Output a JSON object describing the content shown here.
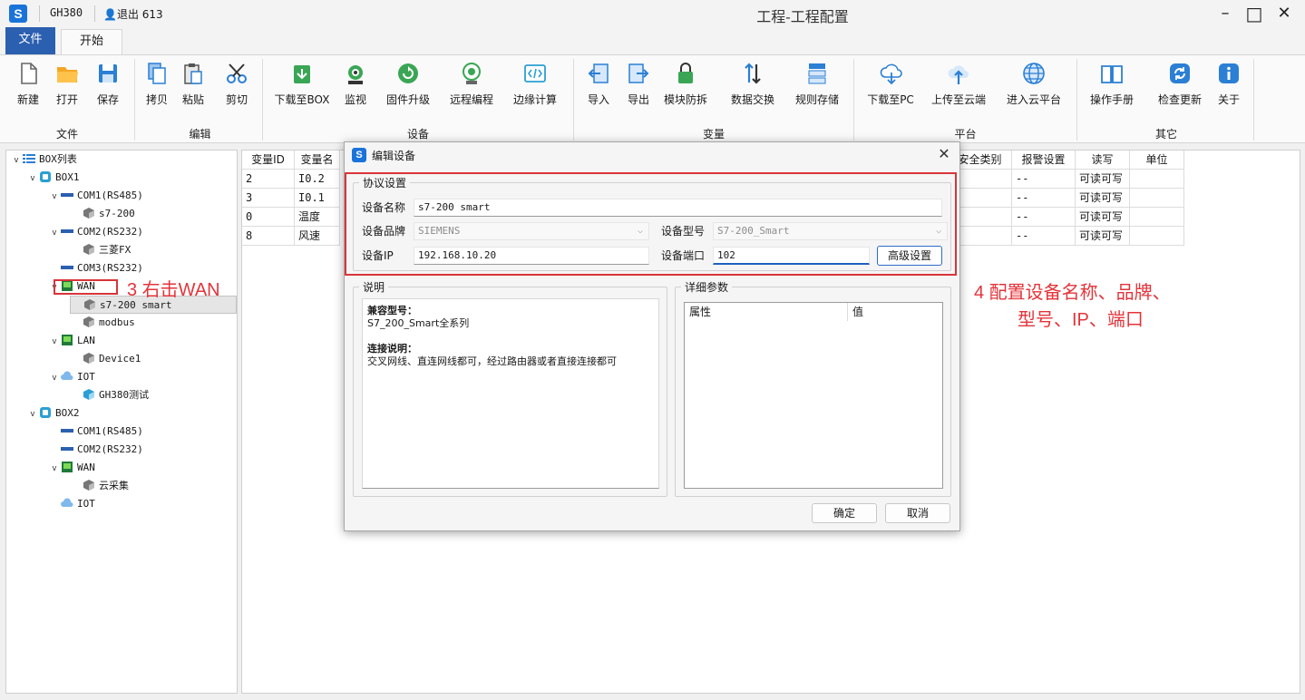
{
  "titlebar": {
    "logo_letter": "S",
    "box_name": "GH380",
    "logout": "退出 613",
    "title": "工程-工程配置",
    "min": "–",
    "max": "□",
    "close": "✕"
  },
  "menu": {
    "file": "文件",
    "start": "开始"
  },
  "ribbon": {
    "groups": [
      {
        "label": "文件"
      },
      {
        "label": "编辑"
      },
      {
        "label": "设备"
      },
      {
        "label": "变量"
      },
      {
        "label": "平台"
      },
      {
        "label": "其它"
      }
    ],
    "buttons": [
      {
        "label": "新建",
        "icon": "new-file-icon",
        "color": "#666666"
      },
      {
        "label": "打开",
        "icon": "open-folder-icon",
        "color": "#f5a623"
      },
      {
        "label": "保存",
        "icon": "save-icon",
        "color": "#2b7fd4"
      },
      {
        "label": "拷贝",
        "icon": "copy-icon",
        "color": "#2b7fd4"
      },
      {
        "label": "粘贴",
        "icon": "paste-icon",
        "color": "#555555"
      },
      {
        "label": "剪切",
        "icon": "cut-icon",
        "color": "#2b7fd4"
      },
      {
        "label": "下载至BOX",
        "icon": "download-box-icon",
        "color": "#3aa655"
      },
      {
        "label": "监视",
        "icon": "monitor-icon",
        "color": "#3aa655"
      },
      {
        "label": "固件升级",
        "icon": "firmware-upgrade-icon",
        "color": "#3aa655"
      },
      {
        "label": "远程编程",
        "icon": "remote-program-icon",
        "color": "#3aa655"
      },
      {
        "label": "边缘计算",
        "icon": "edge-compute-icon",
        "color": "#2b9fd4"
      },
      {
        "label": "导入",
        "icon": "import-icon",
        "color": "#2b7fd4"
      },
      {
        "label": "导出",
        "icon": "export-icon",
        "color": "#2b7fd4"
      },
      {
        "label": "模块防拆",
        "icon": "lock-icon",
        "color": "#3aa655"
      },
      {
        "label": "数据交换",
        "icon": "data-exchange-icon",
        "color": "#2b7fd4"
      },
      {
        "label": "规则存储",
        "icon": "rule-storage-icon",
        "color": "#2b7fd4"
      },
      {
        "label": "下载至PC",
        "icon": "cloud-download-icon",
        "color": "#2b7fd4"
      },
      {
        "label": "上传至云端",
        "icon": "cloud-upload-icon",
        "color": "#2b7fd4"
      },
      {
        "label": "进入云平台",
        "icon": "globe-icon",
        "color": "#2b7fd4"
      },
      {
        "label": "操作手册",
        "icon": "manual-icon",
        "color": "#2b7fd4"
      },
      {
        "label": "检查更新",
        "icon": "refresh-icon",
        "color": "#2b7fd4"
      },
      {
        "label": "关于",
        "icon": "info-icon",
        "color": "#2b7fd4"
      }
    ]
  },
  "tree": [
    {
      "label": "BOX列表",
      "chev": "⌄",
      "icon": "list-icon"
    },
    {
      "label": "BOX1",
      "chev": "⌄",
      "icon": "box-icon"
    },
    {
      "label": "COM1(RS485)",
      "chev": "⌄",
      "icon": "serial-port-icon"
    },
    {
      "label": "s7-200",
      "chev": "",
      "icon": "device-cube-icon"
    },
    {
      "label": "COM2(RS232)",
      "chev": "⌄",
      "icon": "serial-port-icon"
    },
    {
      "label": "三菱FX",
      "chev": "",
      "icon": "device-cube-icon"
    },
    {
      "label": "COM3(RS232)",
      "chev": "",
      "icon": "serial-port-icon"
    },
    {
      "label": "WAN",
      "chev": "⌄",
      "icon": "network-port-icon"
    },
    {
      "label": "s7-200 smart",
      "chev": "",
      "icon": "device-cube-icon"
    },
    {
      "label": "modbus",
      "chev": "",
      "icon": "device-cube-icon"
    },
    {
      "label": "LAN",
      "chev": "⌄",
      "icon": "network-port-icon"
    },
    {
      "label": "Device1",
      "chev": "",
      "icon": "device-cube-icon"
    },
    {
      "label": "IOT",
      "chev": "⌄",
      "icon": "cloud-icon"
    },
    {
      "label": "GH380测试",
      "chev": "",
      "icon": "device-cube-blue-icon"
    },
    {
      "label": "BOX2",
      "chev": "⌄",
      "icon": "box-icon"
    },
    {
      "label": "COM1(RS485)",
      "chev": "",
      "icon": "serial-port-icon"
    },
    {
      "label": "COM2(RS232)",
      "chev": "",
      "icon": "serial-port-icon"
    },
    {
      "label": "WAN",
      "chev": "⌄",
      "icon": "network-port-icon"
    },
    {
      "label": "云采集",
      "chev": "",
      "icon": "device-cube-icon"
    },
    {
      "label": "IOT",
      "chev": "",
      "icon": "cloud-icon"
    }
  ],
  "grid": {
    "left_headers": [
      "变量ID",
      "变量名"
    ],
    "right_headers": [
      "安全类别",
      "报警设置",
      "读写",
      "单位"
    ],
    "rows": [
      {
        "id": "2",
        "name": "I0.2",
        "safety": "-",
        "alarm": "--",
        "rw": "可读可写",
        "unit": ""
      },
      {
        "id": "3",
        "name": "I0.1",
        "safety": "-",
        "alarm": "--",
        "rw": "可读可写",
        "unit": ""
      },
      {
        "id": "0",
        "name": "温度",
        "safety": "-",
        "alarm": "--",
        "rw": "可读可写",
        "unit": ""
      },
      {
        "id": "8",
        "name": "风速",
        "safety": "-",
        "alarm": "--",
        "rw": "可读可写",
        "unit": ""
      }
    ]
  },
  "dialog": {
    "title": "编辑设备",
    "close": "✕",
    "protocol_legend": "协议设置",
    "name_label": "设备名称",
    "name_value": "s7-200 smart",
    "brand_label": "设备品牌",
    "brand_value": "SIEMENS",
    "model_label": "设备型号",
    "model_value": "S7-200_Smart",
    "ip_label": "设备IP",
    "ip_value": "192.168.10.20",
    "port_label": "设备端口",
    "port_value": "102",
    "advanced": "高级设置",
    "desc_legend": "说明",
    "desc_compat_title": "兼容型号：",
    "desc_compat": "S7_200_Smart全系列",
    "desc_conn_title": "连接说明：",
    "desc_conn": "交叉网线、直连网线都可，经过路由器或者直接连接都可",
    "detail_legend": "详细参数",
    "detail_col1": "属性",
    "detail_col2": "值",
    "ok": "确定",
    "cancel": "取消"
  },
  "annotations": {
    "step3": "3 右击WAN",
    "step4_line1": "4 配置设备名称、品牌、",
    "step4_line2": "型号、IP、端口",
    "color": "#e3343a"
  }
}
